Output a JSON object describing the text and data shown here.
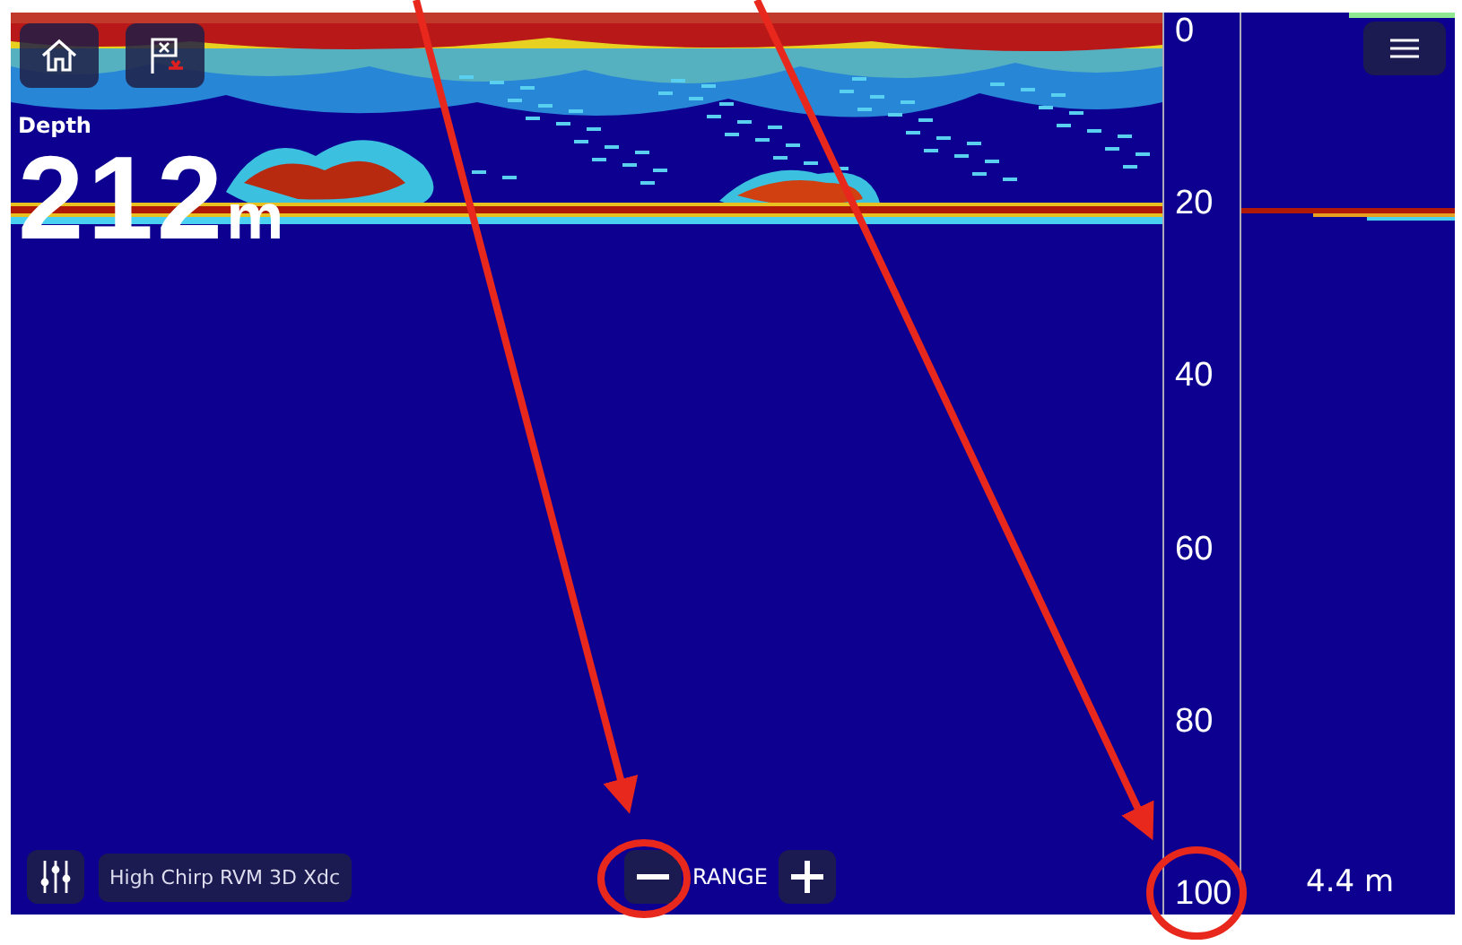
{
  "depth": {
    "label": "Depth",
    "value": "212",
    "unit": "m"
  },
  "scale": {
    "labels": [
      "0",
      "20",
      "40",
      "60",
      "80",
      "100"
    ]
  },
  "bottom_bar": {
    "mode": "High Chirp RVM 3D Xdc",
    "range_label": "RANGE"
  },
  "side_panel": {
    "reading": "4.4 m"
  }
}
